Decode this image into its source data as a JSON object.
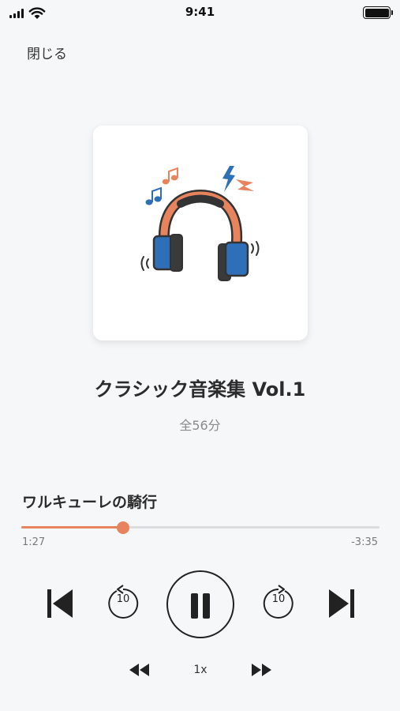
{
  "status_bar": {
    "time": "9:41"
  },
  "header": {
    "close_label": "閉じる"
  },
  "album": {
    "title": "クラシック音楽集 Vol.1",
    "duration": "全56分"
  },
  "now_playing": {
    "track_title": "ワルキューレの騎行",
    "elapsed": "1:27",
    "remaining": "-3:35",
    "progress_fraction": 0.285
  },
  "controls": {
    "skip_back_seconds": "10",
    "skip_forward_seconds": "10",
    "playback_speed": "1x",
    "play_state": "playing"
  },
  "icons": {
    "previous": "skip-previous-icon",
    "rewind10": "rewind-10-icon",
    "pause": "pause-icon",
    "forward10": "forward-10-icon",
    "next": "skip-next-icon",
    "slower": "rewind-icon",
    "faster": "fast-forward-icon"
  },
  "colors": {
    "accent": "#e8845d",
    "background": "#f6f7f9",
    "text_primary": "#2b2b2b",
    "text_secondary": "#8a8a8a"
  }
}
